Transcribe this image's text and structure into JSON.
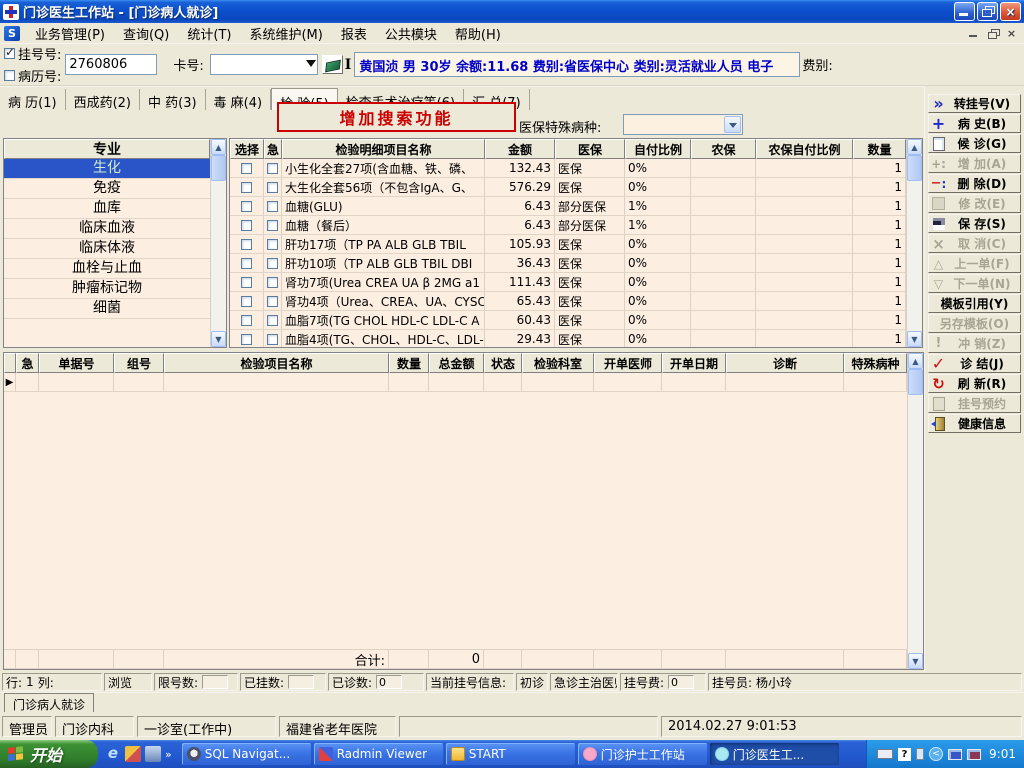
{
  "window": {
    "title": "门诊医生工作站 - [门诊病人就诊]"
  },
  "menu": {
    "items": [
      "业务管理(P)",
      "查询(Q)",
      "统计(T)",
      "系统维护(M)",
      "报表",
      "公共模块",
      "帮助(H)"
    ]
  },
  "patient_bar": {
    "reg_checkbox_checked": true,
    "reg_label": "挂号号:",
    "reg_value": "2760806",
    "record_checkbox_checked": false,
    "record_label": "病历号:",
    "card_label": "卡号:",
    "card_value": "",
    "cursor_mark": "I",
    "info_text": "黄国浈 男 30岁 余额:11.68 费别:省医保中心 类别:灵活就业人员 电子",
    "fee_label": "费别:"
  },
  "tab_bar": {
    "tabs": [
      {
        "label": "病 历(1)",
        "active": false
      },
      {
        "label": "西成药(2)",
        "active": false
      },
      {
        "label": "中 药(3)",
        "active": false
      },
      {
        "label": "毒 麻(4)",
        "active": false
      },
      {
        "label": "检 验(5)",
        "active": true
      },
      {
        "label": "检查手术治疗等(6)",
        "active": false
      },
      {
        "label": "汇 总(7)",
        "active": false
      }
    ]
  },
  "toolbar": {
    "annotation_text": "增加搜索功能",
    "special_disease_label": "医保特殊病种:",
    "special_disease_value": ""
  },
  "specialty_panel": {
    "header": "专业",
    "selected_index": 0,
    "items": [
      "生化",
      "免疫",
      "血库",
      "临床血液",
      "临床体液",
      "血栓与止血",
      "肿瘤标记物",
      "细菌"
    ]
  },
  "detail_table": {
    "headers": [
      "选择",
      "急",
      "检验明细项目名称",
      "金额",
      "医保",
      "自付比例",
      "农保",
      "农保自付比例",
      "数量"
    ],
    "rows": [
      {
        "name": "小生化全套27项(含血糖、铁、磷、",
        "amount": "132.43",
        "insurance": "医保",
        "self_ratio": "0%",
        "rural": "",
        "rural_ratio": "",
        "qty": "1"
      },
      {
        "name": "大生化全套56项（不包含IgA、G、",
        "amount": "576.29",
        "insurance": "医保",
        "self_ratio": "0%",
        "rural": "",
        "rural_ratio": "",
        "qty": "1"
      },
      {
        "name": "血糖(GLU)",
        "amount": "6.43",
        "insurance": "部分医保",
        "self_ratio": "1%",
        "rural": "",
        "rural_ratio": "",
        "qty": "1"
      },
      {
        "name": "血糖（餐后）",
        "amount": "6.43",
        "insurance": "部分医保",
        "self_ratio": "1%",
        "rural": "",
        "rural_ratio": "",
        "qty": "1"
      },
      {
        "name": "肝功17项（TP PA ALB GLB TBIL",
        "amount": "105.93",
        "insurance": "医保",
        "self_ratio": "0%",
        "rural": "",
        "rural_ratio": "",
        "qty": "1"
      },
      {
        "name": "肝功10项（TP ALB GLB TBIL DBI",
        "amount": "36.43",
        "insurance": "医保",
        "self_ratio": "0%",
        "rural": "",
        "rural_ratio": "",
        "qty": "1"
      },
      {
        "name": "肾功7项(Urea CREA UA β 2MG a1",
        "amount": "111.43",
        "insurance": "医保",
        "self_ratio": "0%",
        "rural": "",
        "rural_ratio": "",
        "qty": "1"
      },
      {
        "name": "肾功4项（Urea、CREA、UA、CYSC",
        "amount": "65.43",
        "insurance": "医保",
        "self_ratio": "0%",
        "rural": "",
        "rural_ratio": "",
        "qty": "1"
      },
      {
        "name": "血脂7项(TG CHOL HDL-C LDL-C A",
        "amount": "60.43",
        "insurance": "医保",
        "self_ratio": "0%",
        "rural": "",
        "rural_ratio": "",
        "qty": "1"
      },
      {
        "name": "血脂4项(TG、CHOL、HDL-C、LDL-",
        "amount": "29.43",
        "insurance": "医保",
        "self_ratio": "0%",
        "rural": "",
        "rural_ratio": "",
        "qty": "1"
      }
    ]
  },
  "order_table": {
    "headers": [
      "急",
      "单据号",
      "组号",
      "检验项目名称",
      "数量",
      "总金额",
      "状态",
      "检验科室",
      "开单医师",
      "开单日期",
      "诊断",
      "特殊病种"
    ],
    "row_marker": "▶",
    "total_label": "合计:",
    "total_value": "0"
  },
  "side_panel": {
    "buttons": [
      {
        "label": "转挂号(V)",
        "icon": "chevrons-right-icon",
        "enabled": true
      },
      {
        "label": "病 史(B)",
        "icon": "plus-icon",
        "enabled": true
      },
      {
        "label": "候 诊(G)",
        "icon": "page-icon",
        "enabled": true
      },
      {
        "label": "增 加(A)",
        "icon": "add-icon",
        "enabled": false
      },
      {
        "label": "删 除(D)",
        "icon": "delete-icon",
        "enabled": true
      },
      {
        "label": "修 改(E)",
        "icon": "edit-icon",
        "enabled": false
      },
      {
        "label": "保 存(S)",
        "icon": "floppy-icon",
        "enabled": true
      },
      {
        "label": "取 消(C)",
        "icon": "cancel-icon",
        "enabled": false
      },
      {
        "label": "上一单(F)",
        "icon": "up-icon",
        "enabled": false
      },
      {
        "label": "下一单(N)",
        "icon": "down-icon",
        "enabled": false
      },
      {
        "label": "模板引用(Y)",
        "icon": null,
        "enabled": true
      },
      {
        "label": "另存模板(O)",
        "icon": null,
        "enabled": false
      },
      {
        "label": "冲 销(Z)",
        "icon": "exclaim-icon",
        "enabled": false
      },
      {
        "label": "诊 结(J)",
        "icon": "check-icon",
        "enabled": true
      },
      {
        "label": "刷 新(R)",
        "icon": "refresh-icon",
        "enabled": true
      },
      {
        "label": "挂号预约",
        "icon": "page-icon",
        "enabled": false
      },
      {
        "label": "健康信息",
        "icon": "door-icon",
        "enabled": true
      }
    ]
  },
  "status_bar1": {
    "row_label": "行:",
    "row_value": "1",
    "col_label": "列:",
    "col_value": "",
    "mode": "浏览",
    "limit_label": "限号数:",
    "limit_value": "",
    "registered_label": "已挂数:",
    "registered_value": "",
    "seen_label": "已诊数:",
    "seen_value": "0",
    "current_label": "当前挂号信息:",
    "current_value": "初诊",
    "doctor_type": "急诊主治医师",
    "fee_label": "挂号费:",
    "fee_value": "0",
    "registrar_label": "挂号员:",
    "registrar_value": "杨小玲"
  },
  "workspace_tab": "门诊病人就诊",
  "status_bar2": {
    "panels": [
      "管理员",
      "门诊内科",
      "一诊室(工作中)",
      "福建省老年医院",
      "",
      "2014.02.27 9:01:53"
    ]
  },
  "taskbar": {
    "start_label": "开始",
    "tasks": [
      {
        "label": "SQL Navigat...",
        "icon": "sql-navigator-icon",
        "active": false
      },
      {
        "label": "Radmin Viewer",
        "icon": "radmin-icon",
        "active": false
      },
      {
        "label": "START",
        "icon": "folder-icon",
        "active": false
      },
      {
        "label": "门诊护士工作站",
        "icon": "nurse-app-icon",
        "active": false
      },
      {
        "label": "门诊医生工...",
        "icon": "doctor-app-icon",
        "active": true
      }
    ],
    "clock": "9:01"
  }
}
